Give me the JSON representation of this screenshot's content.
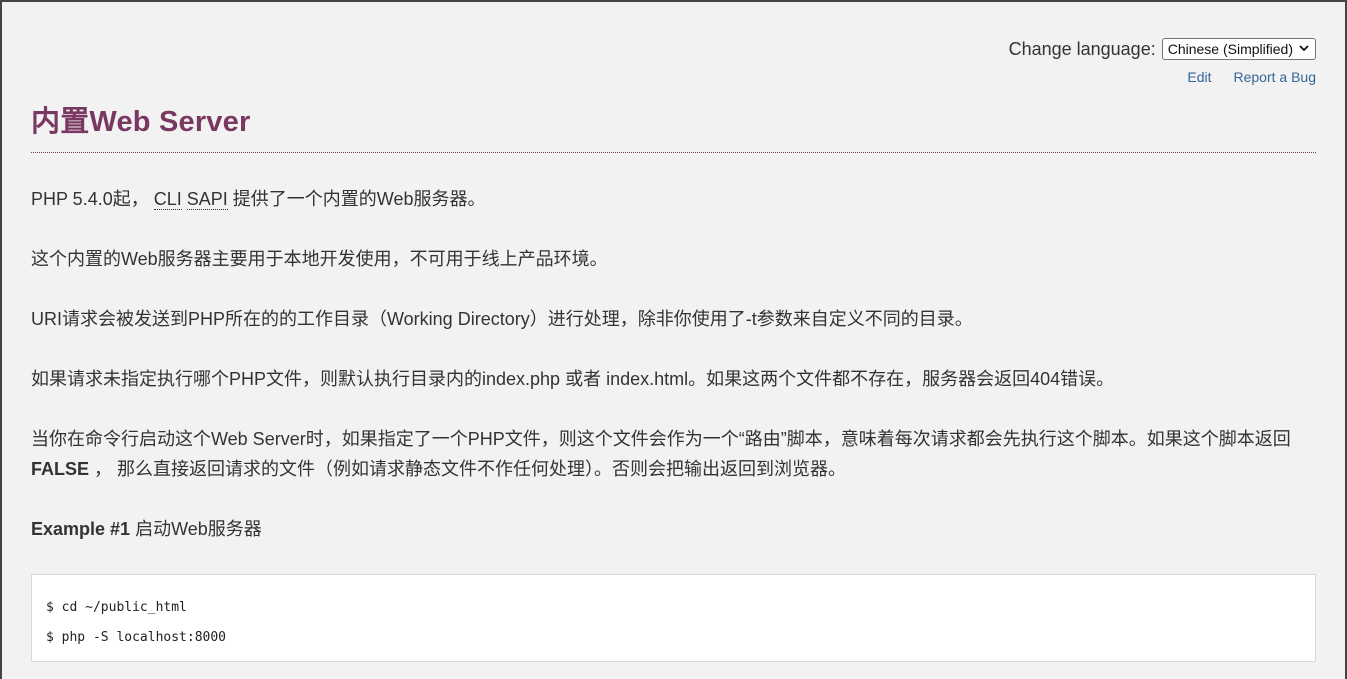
{
  "language_bar": {
    "label": "Change language:",
    "selected": "Chinese (Simplified)",
    "dropdown_icon": "chevron-down-icon"
  },
  "edit_links": {
    "edit": "Edit",
    "report_bug": "Report a Bug"
  },
  "title": "内置Web Server",
  "paragraphs": {
    "p1_before": "PHP 5.4.0起， ",
    "p1_abbr1": "CLI",
    "p1_abbr2": "SAPI",
    "p1_after": " 提供了一个内置的Web服务器。",
    "p2": "这个内置的Web服务器主要用于本地开发使用，不可用于线上产品环境。",
    "p3": "URI请求会被发送到PHP所在的的工作目录（Working Directory）进行处理，除非你使用了-t参数来自定义不同的目录。",
    "p4": "如果请求未指定执行哪个PHP文件，则默认执行目录内的index.php 或者 index.html。如果这两个文件都不存在，服务器会返回404错误。",
    "p5_before": "当你在命令行启动这个Web Server时，如果指定了一个PHP文件，则这个文件会作为一个“路由”脚本，意味着每次请求都会先执行这个脚本。如果这个脚本返回 ",
    "p5_bold": "FALSE",
    "p5_after": " ， 那么直接返回请求的文件（例如请求静态文件不作任何处理）。否则会把输出返回到浏览器。"
  },
  "example": {
    "number": "Example #1",
    "title": " 启动Web服务器",
    "code_lines": [
      "$ cd ~/public_html",
      "$ php -S localhost:8000"
    ]
  },
  "colors": {
    "title": "#793862",
    "link": "#336699",
    "background": "#f2f2f2"
  }
}
